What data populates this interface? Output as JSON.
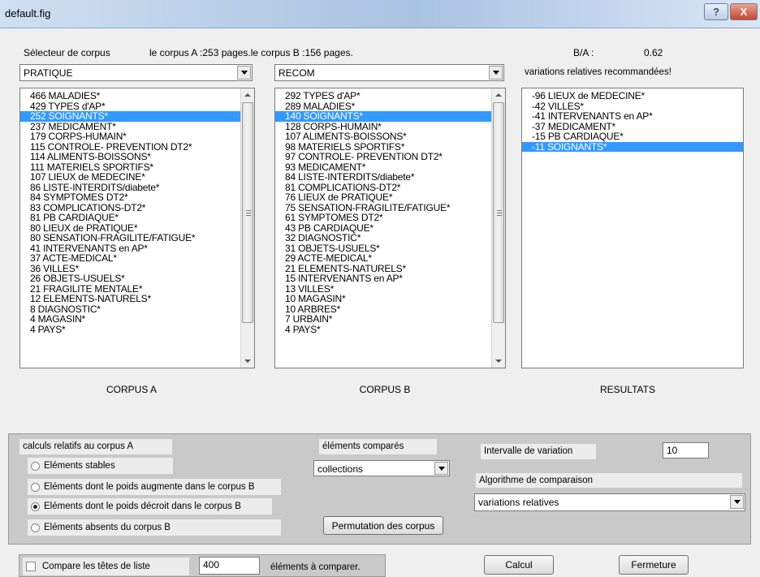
{
  "window": {
    "title": "default.fig",
    "help_symbol": "?",
    "close_symbol": "X"
  },
  "header": {
    "selector_label": "Sélecteur de corpus",
    "corpus_info": "le corpus A :253 pages.le corpus B :156 pages.",
    "ratio_label": "B/A :",
    "ratio_value": "0.62",
    "recommend_text": "variations relatives recommandées!"
  },
  "corpus_a": {
    "combo_value": "PRATIQUE",
    "caption": "CORPUS A",
    "items": [
      {
        "text": "466 MALADIES*",
        "selected": false
      },
      {
        "text": "429 TYPES d'AP*",
        "selected": false
      },
      {
        "text": "252 SOIGNANTS*",
        "selected": true
      },
      {
        "text": "237 MEDICAMENT*",
        "selected": false
      },
      {
        "text": "179 CORPS-HUMAIN*",
        "selected": false
      },
      {
        "text": "115 CONTROLE- PREVENTION DT2*",
        "selected": false
      },
      {
        "text": "114 ALIMENTS-BOISSONS*",
        "selected": false
      },
      {
        "text": "111 MATERIELS SPORTIFS*",
        "selected": false
      },
      {
        "text": "107 LIEUX de MEDECINE*",
        "selected": false
      },
      {
        "text": "86 LISTE-INTERDITS/diabete*",
        "selected": false
      },
      {
        "text": "84 SYMPTOMES DT2*",
        "selected": false
      },
      {
        "text": "83 COMPLICATIONS-DT2*",
        "selected": false
      },
      {
        "text": "81 PB CARDIAQUE*",
        "selected": false
      },
      {
        "text": "80 LIEUX de PRATIQUE*",
        "selected": false
      },
      {
        "text": "80 SENSATION-FRAGILITE/FATIGUE*",
        "selected": false
      },
      {
        "text": "41 INTERVENANTS en AP*",
        "selected": false
      },
      {
        "text": "37 ACTE-MEDICAL*",
        "selected": false
      },
      {
        "text": "36 VILLES*",
        "selected": false
      },
      {
        "text": "26 OBJETS-USUELS*",
        "selected": false
      },
      {
        "text": "21 FRAGILITE MENTALE*",
        "selected": false
      },
      {
        "text": "12 ELEMENTS-NATURELS*",
        "selected": false
      },
      {
        "text": "8 DIAGNOSTIC*",
        "selected": false
      },
      {
        "text": "4 MAGASIN*",
        "selected": false
      },
      {
        "text": "4 PAYS*",
        "selected": false
      }
    ]
  },
  "corpus_b": {
    "combo_value": "RECOM",
    "caption": "CORPUS B",
    "items": [
      {
        "text": "292 TYPES d'AP*",
        "selected": false
      },
      {
        "text": "289 MALADIES*",
        "selected": false
      },
      {
        "text": "140 SOIGNANTS*",
        "selected": true
      },
      {
        "text": "128 CORPS-HUMAIN*",
        "selected": false
      },
      {
        "text": "107 ALIMENTS-BOISSONS*",
        "selected": false
      },
      {
        "text": "98 MATERIELS SPORTIFS*",
        "selected": false
      },
      {
        "text": "97 CONTROLE- PREVENTION DT2*",
        "selected": false
      },
      {
        "text": "93 MEDICAMENT*",
        "selected": false
      },
      {
        "text": "84 LISTE-INTERDITS/diabete*",
        "selected": false
      },
      {
        "text": "81 COMPLICATIONS-DT2*",
        "selected": false
      },
      {
        "text": "76 LIEUX de PRATIQUE*",
        "selected": false
      },
      {
        "text": "75 SENSATION-FRAGILITE/FATIGUE*",
        "selected": false
      },
      {
        "text": "61 SYMPTOMES DT2*",
        "selected": false
      },
      {
        "text": "43 PB CARDIAQUE*",
        "selected": false
      },
      {
        "text": "32 DIAGNOSTIC*",
        "selected": false
      },
      {
        "text": "31 OBJETS-USUELS*",
        "selected": false
      },
      {
        "text": "29 ACTE-MEDICAL*",
        "selected": false
      },
      {
        "text": "21 ELEMENTS-NATURELS*",
        "selected": false
      },
      {
        "text": "15 INTERVENANTS en AP*",
        "selected": false
      },
      {
        "text": "13 VILLES*",
        "selected": false
      },
      {
        "text": "10 MAGASIN*",
        "selected": false
      },
      {
        "text": "10 ARBRES*",
        "selected": false
      },
      {
        "text": "7 URBAIN*",
        "selected": false
      },
      {
        "text": "4 PAYS*",
        "selected": false
      }
    ]
  },
  "results": {
    "caption": "RESULTATS",
    "items": [
      {
        "text": "-96 LIEUX de MEDECINE*",
        "selected": false
      },
      {
        "text": "-42 VILLES*",
        "selected": false
      },
      {
        "text": "-41 INTERVENANTS en AP*",
        "selected": false
      },
      {
        "text": "-37 MEDICAMENT*",
        "selected": false
      },
      {
        "text": "-15 PB CARDIAQUE*",
        "selected": false
      },
      {
        "text": "-11 SOIGNANTS*",
        "selected": true
      }
    ]
  },
  "options": {
    "calc_label": "calculs relatifs au corpus A",
    "radios": [
      {
        "label": "Eléments stables",
        "checked": false
      },
      {
        "label": "Eléments dont le poids augmente dans le corpus B",
        "checked": false
      },
      {
        "label": "Eléments dont le poids décroit dans le corpus B",
        "checked": true
      },
      {
        "label": "Eléments absents du corpus B",
        "checked": false
      }
    ],
    "compared_label": "éléments comparés",
    "compared_value": "collections",
    "permute_label": "Permutation des corpus",
    "interval_label": "Intervalle de variation",
    "interval_value": "10",
    "algo_label": "Algorithme de comparaison",
    "algo_value": "variations relatives"
  },
  "footer": {
    "compare_heads_label": "Compare les têtes de liste",
    "count_value": "400",
    "count_suffix": "éléments à comparer.",
    "calc_button": "Calcul",
    "close_button": "Fermeture"
  }
}
